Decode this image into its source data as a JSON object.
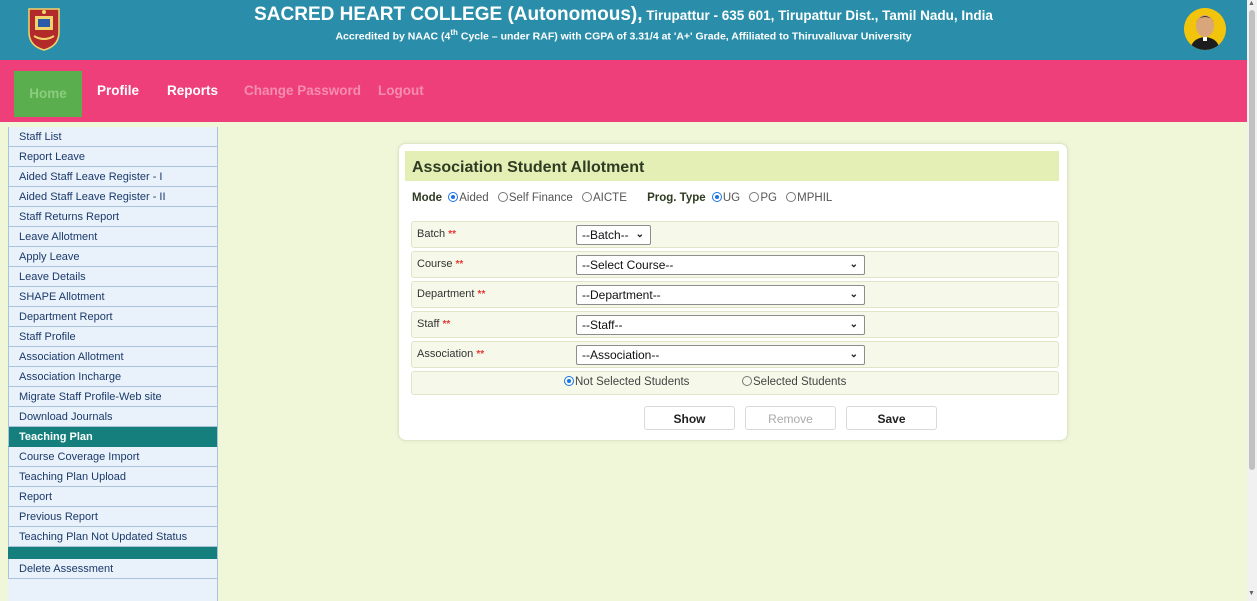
{
  "header": {
    "title_big": "SACRED HEART COLLEGE (Autonomous),",
    "title_rest": " Tirupattur - 635 601, Tirupattur Dist., Tamil Nadu, India",
    "subtitle_pre": "Accredited by NAAC (4",
    "subtitle_sup": "th",
    "subtitle_post": " Cycle – under RAF) with CGPA of 3.31/4 at 'A+' Grade, Affiliated to Thiruvalluvar University",
    "logo_icon": "college-crest-icon",
    "portrait_icon": "founder-portrait"
  },
  "nav": {
    "home": "Home",
    "profile": "Profile",
    "reports": "Reports",
    "change_password": "Change Password",
    "logout": "Logout"
  },
  "sidebar": {
    "items": [
      "Staff List",
      "Report Leave",
      "Aided Staff Leave Register - I",
      "Aided Staff Leave Register - II",
      "Staff Returns Report",
      "Leave Allotment",
      "Apply Leave",
      "Leave Details",
      "SHAPE Allotment",
      "Department Report",
      "Staff Profile",
      "Association Allotment",
      "Association Incharge",
      "Migrate Staff Profile-Web site",
      "Download Journals"
    ],
    "section_heading": "Teaching Plan",
    "section_items": [
      "Course Coverage Import",
      "Teaching Plan Upload",
      "Report",
      "Previous Report",
      "Teaching Plan Not Updated Status"
    ],
    "bottom_item": "Delete Assessment"
  },
  "form": {
    "title": "Association Student Allotment",
    "mode_label": "Mode",
    "mode_options": [
      "Aided",
      "Self Finance",
      "AICTE"
    ],
    "mode_selected": "Aided",
    "prog_label": "Prog. Type",
    "prog_options": [
      "UG",
      "PG",
      "MPHIL"
    ],
    "prog_selected": "UG",
    "required_mark": "**",
    "fields": {
      "batch": {
        "label": "Batch",
        "value": "--Batch--"
      },
      "course": {
        "label": "Course",
        "value": "--Select Course--"
      },
      "department": {
        "label": "Department",
        "value": "--Department--"
      },
      "staff": {
        "label": "Staff",
        "value": "--Staff--"
      },
      "association": {
        "label": "Association",
        "value": "--Association--"
      }
    },
    "student_filter": [
      "Not Selected Students",
      "Selected Students"
    ],
    "student_filter_selected": "Not Selected Students",
    "buttons": {
      "show": "Show",
      "remove": "Remove",
      "save": "Save"
    }
  },
  "colors": {
    "header_bg": "#2a8eaa",
    "nav_bg": "#ef3f7b",
    "home_bg": "#5aae4e",
    "sidebar_heading_bg": "#147f7d",
    "page_bg": "#f0f6d8",
    "panel_title_bg": "#e4efb6"
  }
}
